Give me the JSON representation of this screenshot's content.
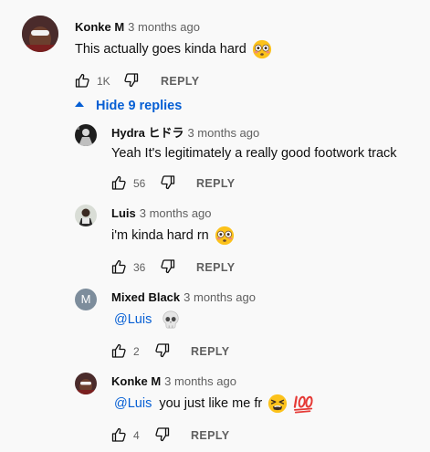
{
  "comment": {
    "author": "Konke M",
    "time": "3 months ago",
    "text": "This actually goes kinda hard",
    "likes": "1K",
    "reply_label": "REPLY"
  },
  "toggle": {
    "label": "Hide 9 replies"
  },
  "replies": [
    {
      "author": "Hydra ヒドラ",
      "time": "3 months ago",
      "text": "Yeah It's legitimately a really good footwork track",
      "likes": "56",
      "reply_label": "REPLY"
    },
    {
      "author": "Luis",
      "time": "3 months ago",
      "text": "i'm kinda hard rn",
      "likes": "36",
      "reply_label": "REPLY"
    },
    {
      "author": "Mixed Black",
      "time": "3 months ago",
      "avatar_letter": "M",
      "mention": "@Luis",
      "likes": "2",
      "reply_label": "REPLY"
    },
    {
      "author": "Konke M",
      "time": "3 months ago",
      "mention": "@Luis",
      "text": "you just like me fr",
      "likes": "4",
      "reply_label": "REPLY"
    }
  ],
  "colors": {
    "link": "#065fd4",
    "secondary": "#606060",
    "avatar_m": "#7d8d9c"
  },
  "icons": [
    "thumbs-up-icon",
    "thumbs-down-icon",
    "caret-up-icon",
    "flushed-emoji-icon",
    "skull-emoji-icon",
    "tired-face-emoji-icon",
    "hundred-points-emoji-icon"
  ]
}
